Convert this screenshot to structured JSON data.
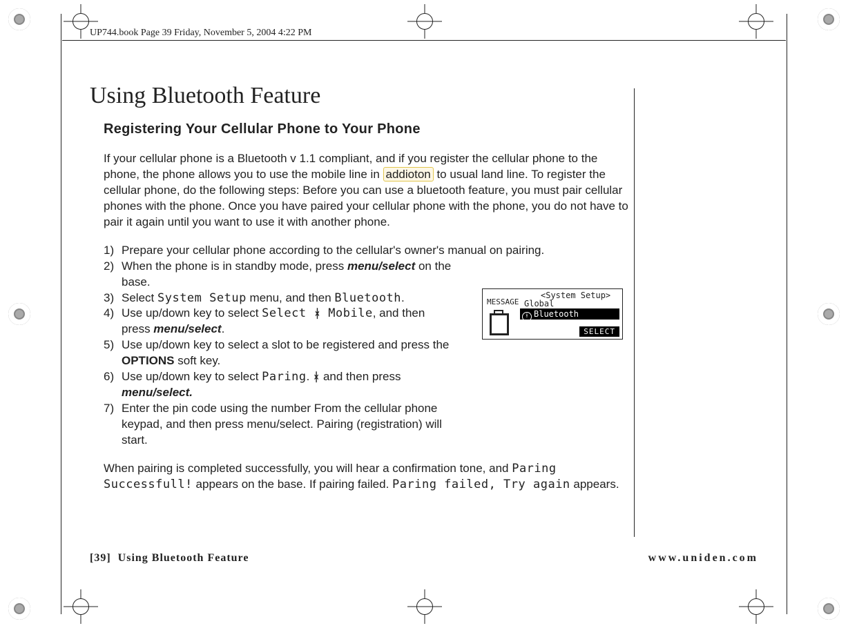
{
  "header": {
    "running_head": "UP744.book  Page 39  Friday, November 5, 2004  4:22 PM"
  },
  "title": "Using Bluetooth Feature",
  "subtitle": "Registering Your Cellular Phone to Your Phone",
  "intro": {
    "p1a": "If your cellular phone is a Bluetooth v 1.1 compliant, and if you register the cellular phone to the phone, the phone allows you to use the mobile line in ",
    "highlight": "addioton",
    "p1b": " to usual land line. To register the cellular phone, do the following steps: Before you can use a bluetooth feature, you must pair cellular phones with the phone. Once you have paired your cellular phone with the phone, you do not have to pair it again until you want to use it with another phone."
  },
  "steps": {
    "s1": {
      "num": "1)",
      "text": "Prepare your cellular phone according to the cellular's owner's manual on pairing."
    },
    "s2": {
      "num": "2)",
      "a": "When the phone is in standby mode, press ",
      "em": "menu/select",
      "b": " on the base."
    },
    "s3": {
      "num": "3)",
      "a": "Select ",
      "lcd1": "System Setup",
      "b": " menu, and then ",
      "lcd2": "Bluetooth",
      "c": "."
    },
    "s4": {
      "num": "4)",
      "a": "Use up/down key to select ",
      "lcd1": "Select ",
      "bt": "ᚼ",
      "lcd2": " Mobile",
      "b": ", and then press ",
      "em": "menu/select",
      "c": "."
    },
    "s5": {
      "num": "5)",
      "a": "Use up/down key to select a slot to be registered and press the ",
      "strong": "OPTIONS",
      "b": " soft key."
    },
    "s6": {
      "num": "6)",
      "a": "Use up/down key to select ",
      "lcd1": "Paring",
      "b": ". ",
      "bt": "ᚼ",
      "c": " and then press ",
      "em": "menu/select.",
      "d": ""
    },
    "s7": {
      "num": "7)",
      "text": "Enter the pin code using the number From the cellular phone keypad, and then press menu/select. Pairing (registration) will start."
    }
  },
  "closing": {
    "a": "When pairing is completed successfully, you will hear a confirmation tone, and ",
    "lcd1": "Paring Successfull!",
    "b": " appears on the base. If pairing failed. ",
    "lcd2": "Paring failed, Try again",
    "c": " appears."
  },
  "lcd": {
    "title": "<System Setup>",
    "message_label": "MESSAGE",
    "line1": "Global",
    "line2": "Bluetooth",
    "softkey": "SELECT"
  },
  "footer": {
    "page_num": "[39]",
    "section": "Using Bluetooth Feature",
    "url": "www.uniden.com"
  }
}
